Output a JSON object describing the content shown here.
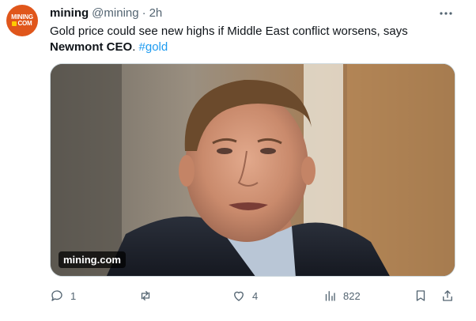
{
  "tweet": {
    "avatar_line1": "MINING",
    "avatar_line2": "COM",
    "name": "mining",
    "handle": "@mining",
    "separator": "·",
    "time": "2h",
    "text_main": "Gold price could see new highs if Middle East conflict worsens, says ",
    "text_bold": "Newmont CEO",
    "text_period": ".",
    "hashtag": "#gold",
    "media": {
      "watermark": "mining.com"
    },
    "actions": {
      "reply_count": "1",
      "retweet_count": "",
      "like_count": "4",
      "view_count": "822"
    },
    "icons": [
      "more-icon",
      "reply-icon",
      "retweet-icon",
      "like-icon",
      "views-icon",
      "bookmark-icon",
      "share-icon"
    ]
  }
}
